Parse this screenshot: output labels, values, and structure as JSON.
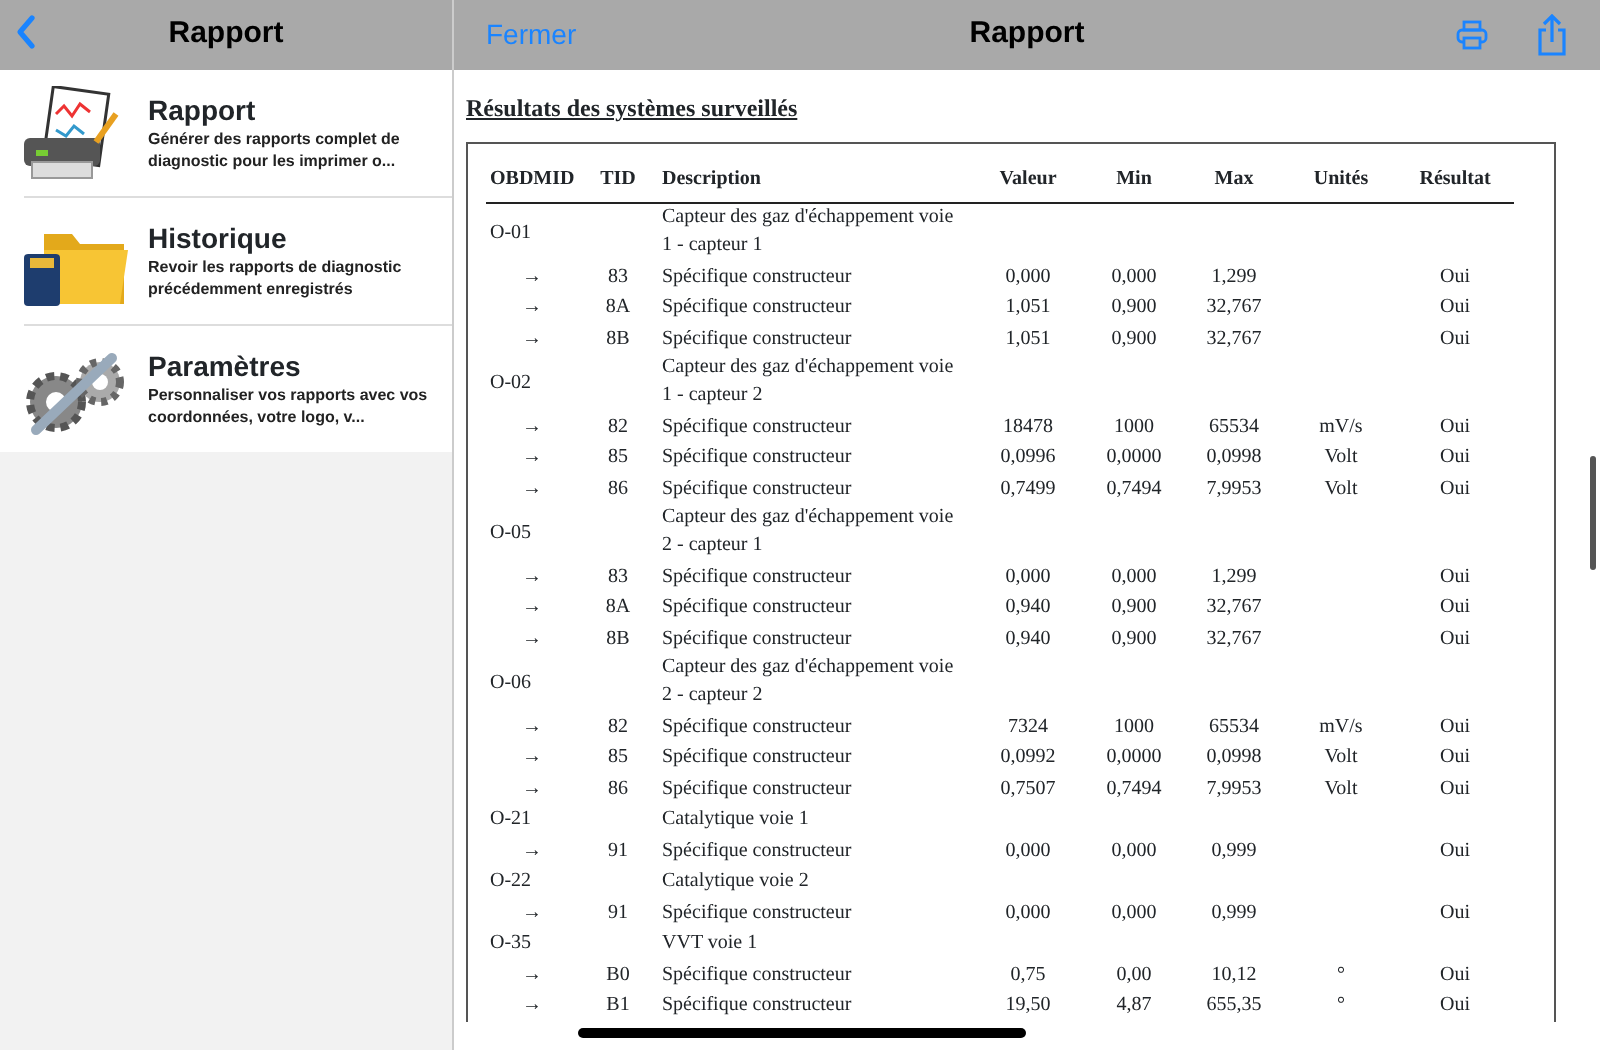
{
  "sidebar": {
    "title": "Rapport",
    "items": [
      {
        "title": "Rapport",
        "description": "Générer des rapports complet de diagnostic pour les imprimer o..."
      },
      {
        "title": "Historique",
        "description": "Revoir les rapports de diagnostic précédemment enregistrés"
      },
      {
        "title": "Paramètres",
        "description": "Personnaliser vos rapports avec vos coordonnées, votre logo, v..."
      }
    ]
  },
  "navbar": {
    "close_label": "Fermer",
    "title": "Rapport"
  },
  "report": {
    "heading": "Résultats des systèmes surveillés",
    "columns": [
      "OBDMID",
      "TID",
      "Description",
      "Valeur",
      "Min",
      "Max",
      "Unités",
      "Résultat"
    ],
    "rows": [
      {
        "kind": "group",
        "obdmid": "O-01",
        "description": "Capteur des gaz d'échappement voie 1 - capteur 1"
      },
      {
        "kind": "test",
        "obdmid": "→",
        "tid": "83",
        "description": "Spécifique constructeur",
        "value": "0,000",
        "min": "0,000",
        "max": "1,299",
        "unit": "",
        "result": "Oui"
      },
      {
        "kind": "test",
        "obdmid": "→",
        "tid": "8A",
        "description": "Spécifique constructeur",
        "value": "1,051",
        "min": "0,900",
        "max": "32,767",
        "unit": "",
        "result": "Oui"
      },
      {
        "kind": "test",
        "obdmid": "→",
        "tid": "8B",
        "description": "Spécifique constructeur",
        "value": "1,051",
        "min": "0,900",
        "max": "32,767",
        "unit": "",
        "result": "Oui"
      },
      {
        "kind": "group",
        "obdmid": "O-02",
        "description": "Capteur des gaz d'échappement voie 1 - capteur 2"
      },
      {
        "kind": "test",
        "obdmid": "→",
        "tid": "82",
        "description": "Spécifique constructeur",
        "value": "18478",
        "min": "1000",
        "max": "65534",
        "unit": "mV/s",
        "result": "Oui"
      },
      {
        "kind": "test",
        "obdmid": "→",
        "tid": "85",
        "description": "Spécifique constructeur",
        "value": "0,0996",
        "min": "0,0000",
        "max": "0,0998",
        "unit": "Volt",
        "result": "Oui"
      },
      {
        "kind": "test",
        "obdmid": "→",
        "tid": "86",
        "description": "Spécifique constructeur",
        "value": "0,7499",
        "min": "0,7494",
        "max": "7,9953",
        "unit": "Volt",
        "result": "Oui"
      },
      {
        "kind": "group",
        "obdmid": "O-05",
        "description": "Capteur des gaz d'échappement voie 2 - capteur 1"
      },
      {
        "kind": "test",
        "obdmid": "→",
        "tid": "83",
        "description": "Spécifique constructeur",
        "value": "0,000",
        "min": "0,000",
        "max": "1,299",
        "unit": "",
        "result": "Oui"
      },
      {
        "kind": "test",
        "obdmid": "→",
        "tid": "8A",
        "description": "Spécifique constructeur",
        "value": "0,940",
        "min": "0,900",
        "max": "32,767",
        "unit": "",
        "result": "Oui"
      },
      {
        "kind": "test",
        "obdmid": "→",
        "tid": "8B",
        "description": "Spécifique constructeur",
        "value": "0,940",
        "min": "0,900",
        "max": "32,767",
        "unit": "",
        "result": "Oui"
      },
      {
        "kind": "group",
        "obdmid": "O-06",
        "description": "Capteur des gaz d'échappement voie 2 - capteur 2"
      },
      {
        "kind": "test",
        "obdmid": "→",
        "tid": "82",
        "description": "Spécifique constructeur",
        "value": "7324",
        "min": "1000",
        "max": "65534",
        "unit": "mV/s",
        "result": "Oui"
      },
      {
        "kind": "test",
        "obdmid": "→",
        "tid": "85",
        "description": "Spécifique constructeur",
        "value": "0,0992",
        "min": "0,0000",
        "max": "0,0998",
        "unit": "Volt",
        "result": "Oui"
      },
      {
        "kind": "test",
        "obdmid": "→",
        "tid": "86",
        "description": "Spécifique constructeur",
        "value": "0,7507",
        "min": "0,7494",
        "max": "7,9953",
        "unit": "Volt",
        "result": "Oui"
      },
      {
        "kind": "group",
        "obdmid": "O-21",
        "description": "Catalytique voie 1"
      },
      {
        "kind": "test",
        "obdmid": "→",
        "tid": "91",
        "description": "Spécifique constructeur",
        "value": "0,000",
        "min": "0,000",
        "max": "0,999",
        "unit": "",
        "result": "Oui"
      },
      {
        "kind": "group",
        "obdmid": "O-22",
        "description": "Catalytique voie 2"
      },
      {
        "kind": "test",
        "obdmid": "→",
        "tid": "91",
        "description": "Spécifique constructeur",
        "value": "0,000",
        "min": "0,000",
        "max": "0,999",
        "unit": "",
        "result": "Oui"
      },
      {
        "kind": "group",
        "obdmid": "O-35",
        "description": "VVT voie 1"
      },
      {
        "kind": "test",
        "obdmid": "→",
        "tid": "B0",
        "description": "Spécifique constructeur",
        "value": "0,75",
        "min": "0,00",
        "max": "10,12",
        "unit": "°",
        "result": "Oui"
      },
      {
        "kind": "test",
        "obdmid": "→",
        "tid": "B1",
        "description": "Spécifique constructeur",
        "value": "19,50",
        "min": "4,87",
        "max": "655,35",
        "unit": "°",
        "result": "Oui"
      }
    ]
  }
}
